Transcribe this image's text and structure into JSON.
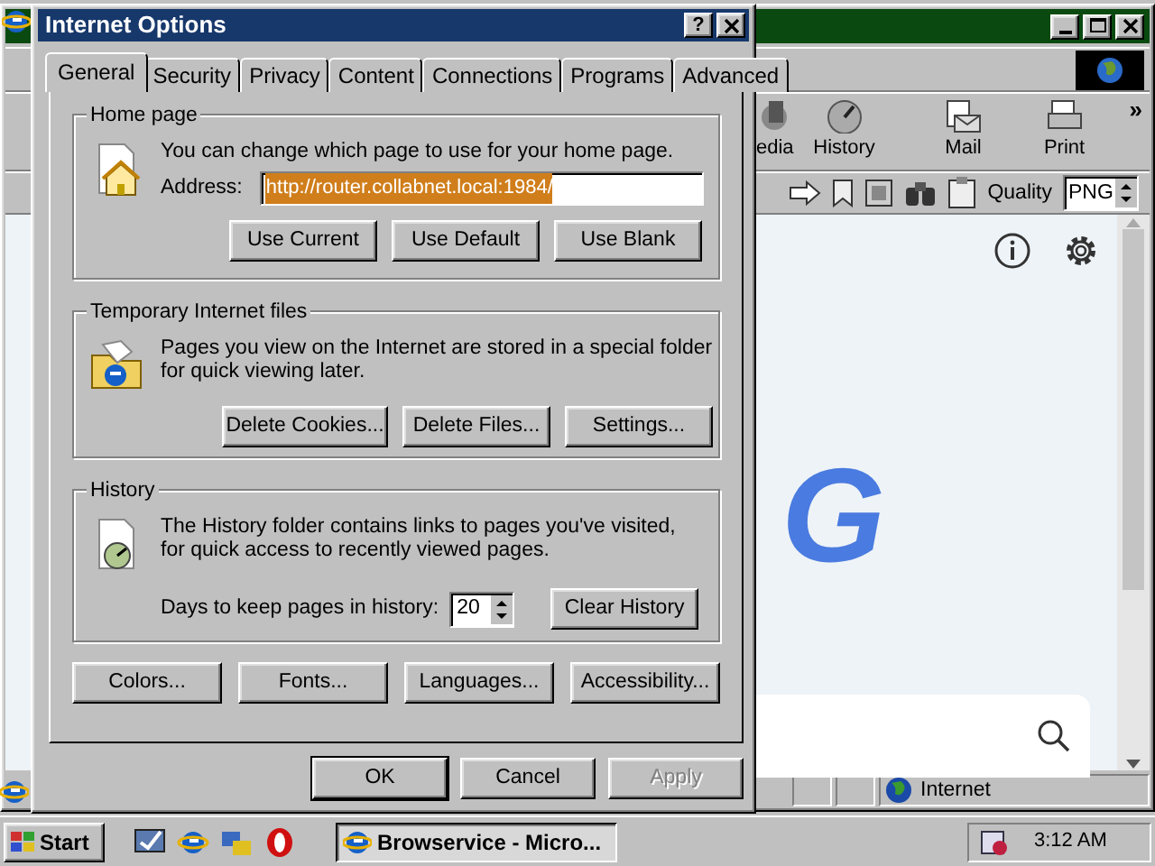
{
  "browser": {
    "toolbar_buttons": [
      {
        "label": "edia"
      },
      {
        "label": "History"
      },
      {
        "label": "Mail"
      },
      {
        "label": "Print"
      }
    ],
    "overflow": "»",
    "quality_label": "Quality",
    "quality_value": "PNG",
    "page_text": "G",
    "status": "Internet"
  },
  "dialog": {
    "title": "Internet Options",
    "help": "?",
    "tabs": [
      {
        "label": "General",
        "selected": true
      },
      {
        "label": "Security",
        "selected": false
      },
      {
        "label": "Privacy",
        "selected": false
      },
      {
        "label": "Content",
        "selected": false
      },
      {
        "label": "Connections",
        "selected": false
      },
      {
        "label": "Programs",
        "selected": false
      },
      {
        "label": "Advanced",
        "selected": false
      }
    ],
    "home_page": {
      "legend": "Home page",
      "text": "You can change which page to use for your home page.",
      "address_label": "Address:",
      "address": "http://router.collabnet.local:1984/",
      "address_selected": true,
      "buttons": [
        "Use Current",
        "Use Default",
        "Use Blank"
      ]
    },
    "temporary_files": {
      "legend": "Temporary Internet files",
      "text": "Pages you view on the Internet are stored in a special folder for quick viewing later.",
      "buttons": [
        "Delete Cookies...",
        "Delete Files...",
        "Settings..."
      ]
    },
    "history": {
      "legend": "History",
      "text": "The History folder contains links to pages you've visited, for quick access to recently viewed pages.",
      "days_label": "Days to keep pages in history:",
      "days": "20",
      "button": "Clear History"
    },
    "bottom_buttons": [
      "Colors...",
      "Fonts...",
      "Languages...",
      "Accessibility..."
    ],
    "dialog_buttons": [
      {
        "label": "OK",
        "disabled": false
      },
      {
        "label": "Cancel",
        "disabled": false
      },
      {
        "label": "Apply",
        "disabled": true
      }
    ]
  },
  "taskbar": {
    "start": "Start",
    "task": "Browservice - Micro...",
    "clock": "3:12 AM"
  }
}
